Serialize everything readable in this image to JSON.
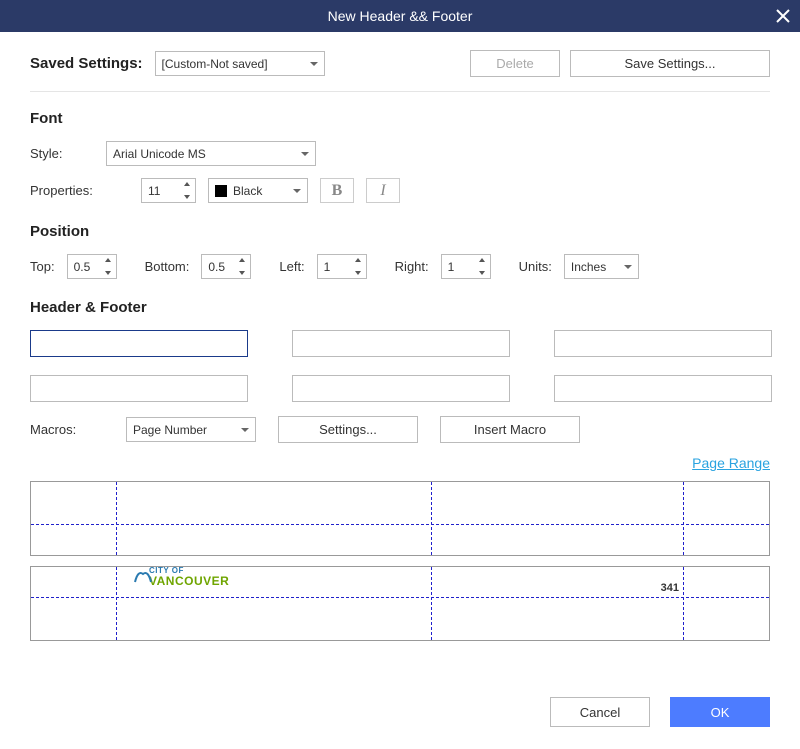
{
  "titlebar": {
    "title": "New Header && Footer"
  },
  "savedSettings": {
    "label": "Saved Settings:",
    "value": "[Custom-Not saved]",
    "deleteLabel": "Delete",
    "saveLabel": "Save Settings..."
  },
  "font": {
    "sectionTitle": "Font",
    "styleLabel": "Style:",
    "styleValue": "Arial Unicode MS",
    "propertiesLabel": "Properties:",
    "sizeValue": "11",
    "colorValue": "Black",
    "boldLabel": "B",
    "italicLabel": "I"
  },
  "position": {
    "sectionTitle": "Position",
    "topLabel": "Top:",
    "topValue": "0.5",
    "bottomLabel": "Bottom:",
    "bottomValue": "0.5",
    "leftLabel": "Left:",
    "leftValue": "1",
    "rightLabel": "Right:",
    "rightValue": "1",
    "unitsLabel": "Units:",
    "unitsValue": "Inches"
  },
  "headerFooter": {
    "sectionTitle": "Header & Footer",
    "macrosLabel": "Macros:",
    "macroValue": "Page Number",
    "settingsLabel": "Settings...",
    "insertLabel": "Insert Macro",
    "pageRangeLabel": "Page Range"
  },
  "preview": {
    "logoTop": "CITY OF",
    "logoBottom": "VANCOUVER",
    "pageNum": "341"
  },
  "footer": {
    "cancelLabel": "Cancel",
    "okLabel": "OK"
  }
}
